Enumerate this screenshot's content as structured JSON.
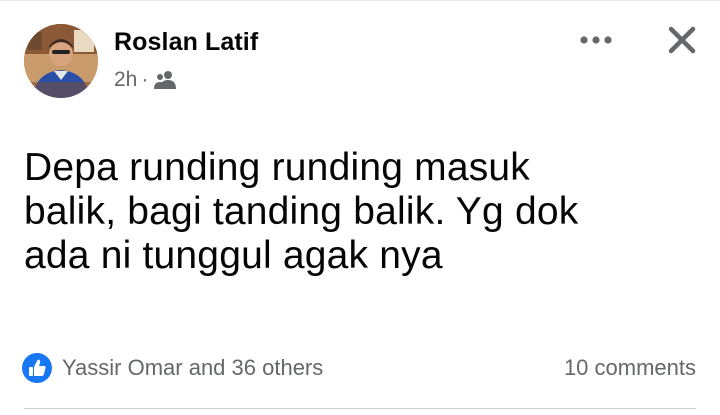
{
  "post": {
    "author": "Roslan Latif",
    "time": "2h",
    "separator": "·",
    "audience_icon": "friends-icon",
    "text": "Depa runding runding masuk\nbalik, bagi tanding balik. Yg dok\nada ni tunggul agak nya"
  },
  "actions": {
    "more_icon": "more-horizontal-icon",
    "close_icon": "close-icon"
  },
  "footer": {
    "reaction_icon": "like-icon",
    "reactions_label": "Yassir Omar and 36 others",
    "comments_label": "10 comments"
  },
  "colors": {
    "text_primary": "#050505",
    "text_secondary": "#65676b",
    "like_blue": "#1877f2",
    "divider": "#ced0d4"
  }
}
